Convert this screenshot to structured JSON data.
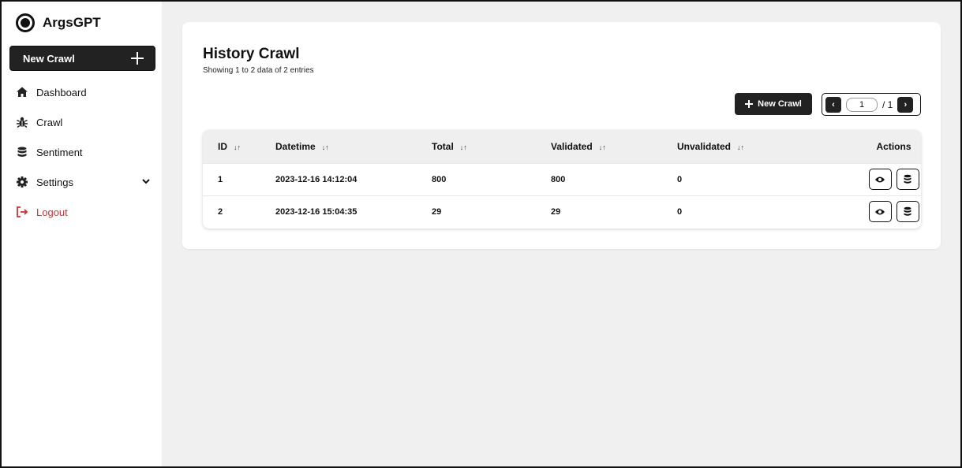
{
  "brand": {
    "name": "ArgsGPT"
  },
  "sidebar": {
    "new_crawl_label": "New Crawl",
    "items": [
      {
        "label": "Dashboard",
        "icon": "home-icon"
      },
      {
        "label": "Crawl",
        "icon": "bug-icon"
      },
      {
        "label": "Sentiment",
        "icon": "database-icon"
      },
      {
        "label": "Settings",
        "icon": "gear-icon"
      },
      {
        "label": "Logout",
        "icon": "logout-icon"
      }
    ]
  },
  "main": {
    "title": "History Crawl",
    "subtitle": "Showing 1 to 2 data of 2 entries",
    "new_crawl_label": "New Crawl",
    "pager": {
      "current": "1",
      "total": "/ 1"
    },
    "table": {
      "headers": [
        "ID",
        "Datetime",
        "Total",
        "Validated",
        "Unvalidated",
        "Actions"
      ],
      "rows": [
        {
          "id": "1",
          "datetime": "2023-12-16 14:12:04",
          "total": "800",
          "validated": "800",
          "unvalidated": "0"
        },
        {
          "id": "2",
          "datetime": "2023-12-16 15:04:35",
          "total": "29",
          "validated": "29",
          "unvalidated": "0"
        }
      ]
    }
  },
  "colors": {
    "accent": "#222222",
    "logout": "#d32f2f",
    "background": "#f0f0f0"
  }
}
